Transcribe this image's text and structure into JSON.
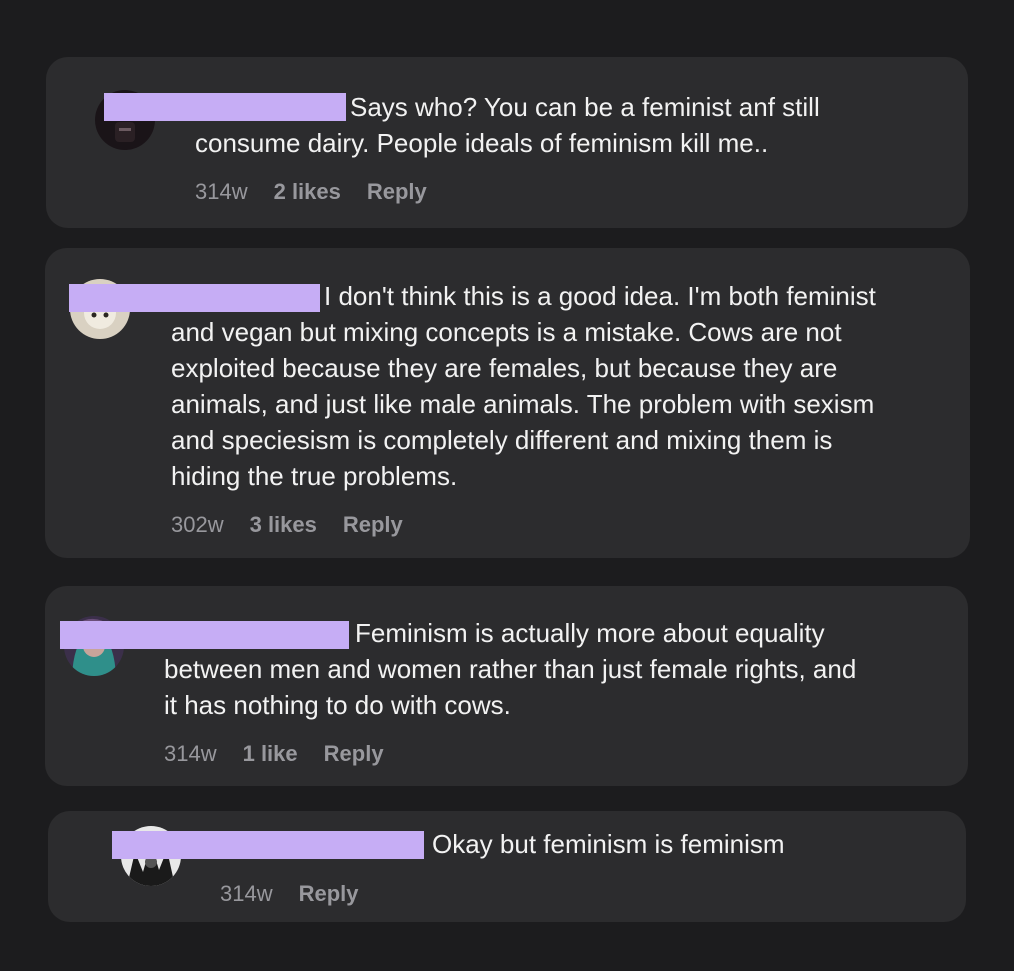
{
  "comments": [
    {
      "text_lines": [
        "Says who? You can be a feminist anf still",
        "consume dairy. People ideals of feminism kill me.."
      ],
      "age": "314w",
      "likes": "2 likes",
      "reply": "Reply"
    },
    {
      "text_lines": [
        "I don't think this is a good idea. I'm both feminist",
        "and vegan but mixing concepts is a mistake. Cows are not",
        "exploited because they are females, but because they are",
        "animals, and just like male animals. The problem with sexism",
        "and speciesism is completely different and mixing them is",
        "hiding the true problems."
      ],
      "age": "302w",
      "likes": "3 likes",
      "reply": "Reply"
    },
    {
      "text_lines": [
        "Feminism is actually more about equality",
        "between men and women rather than just female rights, and",
        "it has nothing to do with cows."
      ],
      "age": "314w",
      "likes": "1 like",
      "reply": "Reply"
    },
    {
      "text_lines": [
        "Okay but feminism is feminism"
      ],
      "age": "314w",
      "reply": "Reply"
    }
  ],
  "colors": {
    "background": "#1c1c1e",
    "card": "#2c2c2e",
    "redaction": "#c6adf5",
    "text": "#f2f2f2",
    "meta": "#98989d"
  }
}
